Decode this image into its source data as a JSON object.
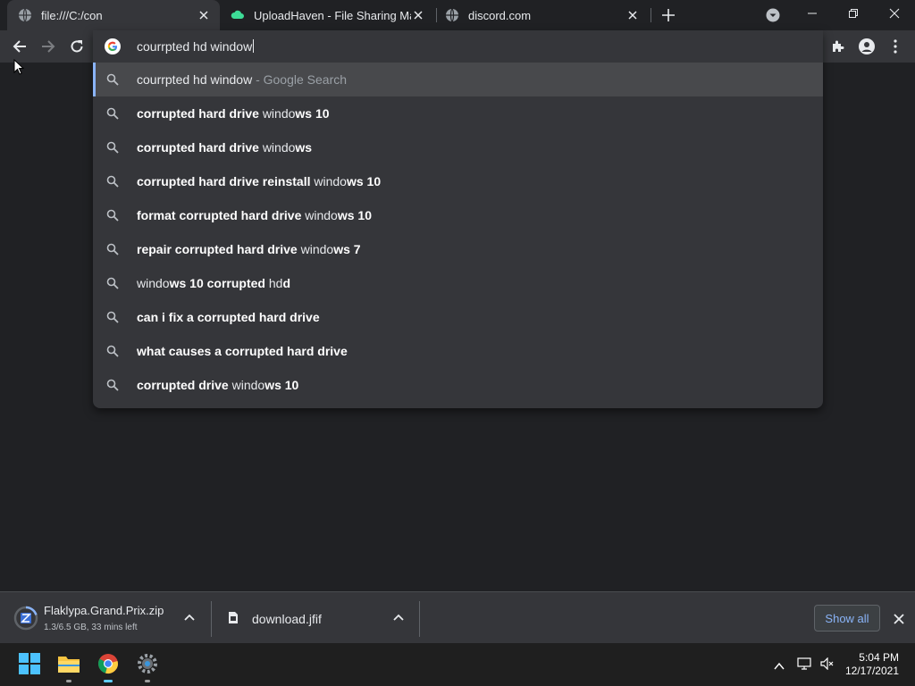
{
  "tabs": [
    {
      "title": "file:///C:/con",
      "favicon": "globe-icon",
      "active": true
    },
    {
      "title": "UploadHaven - File Sharing Made",
      "favicon": "cloud-icon",
      "active": false
    },
    {
      "title": "discord.com",
      "favicon": "globe-icon",
      "active": false
    }
  ],
  "omnibox": {
    "value": "courrpted hd window",
    "search_engine_icon": "google-icon"
  },
  "suggestions": [
    {
      "parts": [
        {
          "t": "courrpted hd window",
          "b": false
        },
        {
          "t": " - Google Search",
          "b": false,
          "dim": true
        }
      ],
      "selected": true
    },
    {
      "parts": [
        {
          "t": "corrupted hard drive ",
          "b": true
        },
        {
          "t": "windo",
          "b": false
        },
        {
          "t": "ws 10",
          "b": true
        }
      ]
    },
    {
      "parts": [
        {
          "t": "corrupted hard drive ",
          "b": true
        },
        {
          "t": "windo",
          "b": false
        },
        {
          "t": "ws",
          "b": true
        }
      ]
    },
    {
      "parts": [
        {
          "t": "corrupted hard drive reinstall ",
          "b": true
        },
        {
          "t": "windo",
          "b": false
        },
        {
          "t": "ws 10",
          "b": true
        }
      ]
    },
    {
      "parts": [
        {
          "t": "format corrupted hard drive ",
          "b": true
        },
        {
          "t": "windo",
          "b": false
        },
        {
          "t": "ws 10",
          "b": true
        }
      ]
    },
    {
      "parts": [
        {
          "t": "repair corrupted hard drive ",
          "b": true
        },
        {
          "t": "windo",
          "b": false
        },
        {
          "t": "ws 7",
          "b": true
        }
      ]
    },
    {
      "parts": [
        {
          "t": "windo",
          "b": false
        },
        {
          "t": "ws 10 corrupted ",
          "b": true
        },
        {
          "t": "hd",
          "b": false
        },
        {
          "t": "d",
          "b": true
        }
      ]
    },
    {
      "parts": [
        {
          "t": "can i fix a corrupted hard drive",
          "b": true
        }
      ]
    },
    {
      "parts": [
        {
          "t": "what causes a corrupted hard drive",
          "b": true
        }
      ]
    },
    {
      "parts": [
        {
          "t": "corrupted drive ",
          "b": true
        },
        {
          "t": "windo",
          "b": false
        },
        {
          "t": "ws 10",
          "b": true
        }
      ]
    }
  ],
  "downloads": [
    {
      "name": "Flaklypa.Grand.Prix.zip",
      "status": "1.3/6.5 GB, 33 mins left",
      "progress_fraction": 0.2
    },
    {
      "name": "download.jfif",
      "status": ""
    }
  ],
  "show_all_label": "Show all",
  "clock": {
    "time": "5:04 PM",
    "date": "12/17/2021"
  },
  "colors": {
    "accent": "#8ab4f8",
    "background": "#202124",
    "surface": "#35363a"
  }
}
